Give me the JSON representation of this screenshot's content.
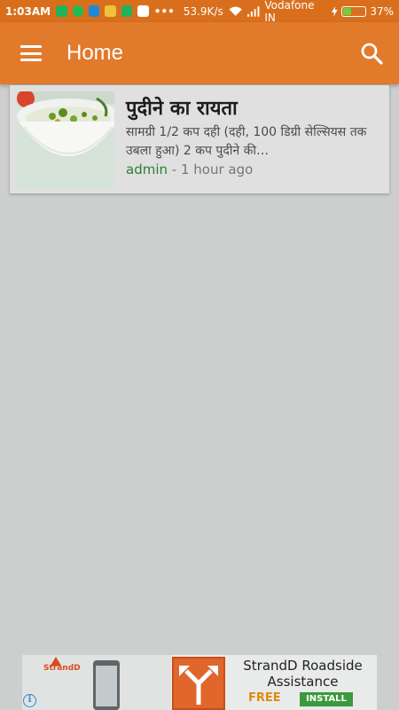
{
  "status_bar": {
    "time": "1:03AM",
    "network_speed": "53.9K/s",
    "carrier": "Vodafone IN",
    "battery_percent": "37%",
    "battery_level": 0.37,
    "notification_icons": [
      "shield-icon",
      "whatsapp-icon",
      "truecaller-icon",
      "photos-icon",
      "shield-icon",
      "gmail-icon"
    ],
    "colors": {
      "background": "#d96f1d",
      "battery_fill": "#6cd13c"
    }
  },
  "app_bar": {
    "title": "Home",
    "icons": [
      "menu-icon",
      "search-icon"
    ],
    "colors": {
      "background": "#e27a2b"
    }
  },
  "posts": [
    {
      "title": "पुदीने का रायता",
      "excerpt": "सामग्री 1/2 कप दही (दही, 100 डिग्री सेल्सियस तक उबला हुआ) 2 कप पुदीने की…",
      "author": "admin",
      "separator": " - ",
      "time_ago": "1 hour ago"
    }
  ],
  "ad": {
    "brand": "StrandD",
    "title": "StrandD Roadside Assistance",
    "price": "FREE",
    "cta": "INSTALL",
    "info_icon": "i"
  }
}
